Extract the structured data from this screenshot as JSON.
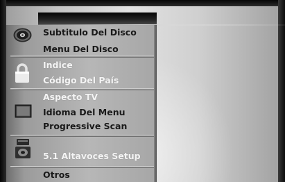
{
  "menu": {
    "groups": [
      {
        "icon": "disc-icon",
        "items": [
          {
            "label": "Subtitulo Del Disco",
            "style": "normal"
          },
          {
            "label": "Menu Del Disco",
            "style": "normal"
          }
        ]
      },
      {
        "icon": "lock-icon",
        "items": [
          {
            "label": "Indice",
            "style": "light"
          },
          {
            "label": "Código Del País",
            "style": "light"
          }
        ]
      },
      {
        "icon": "tv-screen-icon",
        "items": [
          {
            "label": "Aspecto TV",
            "style": "light"
          },
          {
            "label": "Idioma Del Menu",
            "style": "normal"
          },
          {
            "label": "Progressive Scan",
            "style": "normal"
          }
        ]
      },
      {
        "icon": "speaker-icon",
        "items": [
          {
            "label": "5.1 Altavoces Setup",
            "style": "light"
          }
        ]
      },
      {
        "icon": "",
        "items": [
          {
            "label": "Otros",
            "style": "normal"
          }
        ]
      }
    ]
  }
}
